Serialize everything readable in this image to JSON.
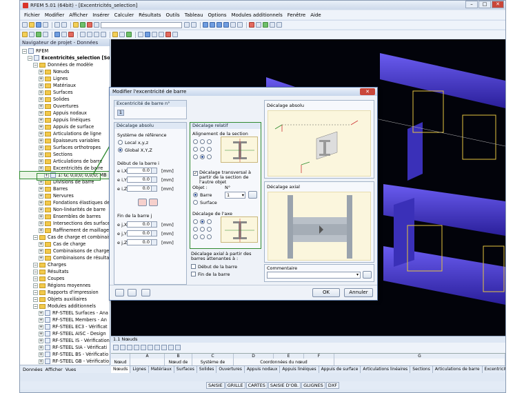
{
  "app": {
    "title": "RFEM 5.01 (64bit) - [Excentricités_selection]",
    "window_buttons": [
      "–",
      "□",
      "✕"
    ]
  },
  "menu": [
    "Fichier",
    "Modifier",
    "Afficher",
    "Insérer",
    "Calculer",
    "Résultats",
    "Outils",
    "Tableau",
    "Options",
    "Modules additionnels",
    "Fenêtre",
    "Aide"
  ],
  "navigator": {
    "title": "Navigateur de projet - Données",
    "tree": [
      {
        "label": "RFEM",
        "level": 0,
        "kind": "doc"
      },
      {
        "label": "Excentricités_selection [Sozial",
        "level": 1,
        "kind": "doc",
        "bold": true
      },
      {
        "label": "Données de modèle",
        "level": 2,
        "kind": "folder"
      },
      {
        "label": "Nœuds",
        "level": 3,
        "kind": "folder"
      },
      {
        "label": "Lignes",
        "level": 3,
        "kind": "folder"
      },
      {
        "label": "Matériaux",
        "level": 3,
        "kind": "folder"
      },
      {
        "label": "Surfaces",
        "level": 3,
        "kind": "folder"
      },
      {
        "label": "Solides",
        "level": 3,
        "kind": "folder"
      },
      {
        "label": "Ouvertures",
        "level": 3,
        "kind": "folder"
      },
      {
        "label": "Appuis nodaux",
        "level": 3,
        "kind": "folder"
      },
      {
        "label": "Appuis linéiques",
        "level": 3,
        "kind": "folder"
      },
      {
        "label": "Appuis de surface",
        "level": 3,
        "kind": "folder"
      },
      {
        "label": "Articulations de ligne",
        "level": 3,
        "kind": "folder"
      },
      {
        "label": "Épaisseurs variables",
        "level": 3,
        "kind": "folder"
      },
      {
        "label": "Surfaces orthotropes",
        "level": 3,
        "kind": "folder"
      },
      {
        "label": "Sections",
        "level": 3,
        "kind": "folder"
      },
      {
        "label": "Articulations de barre",
        "level": 3,
        "kind": "folder"
      },
      {
        "label": "Excentricités de barre",
        "level": 3,
        "kind": "folder"
      },
      {
        "label": "1: G; 0,0;0; 0,0;0; MB",
        "level": 4,
        "kind": "doc",
        "selected": true
      },
      {
        "label": "Divisions de barre",
        "level": 3,
        "kind": "folder"
      },
      {
        "label": "Barres",
        "level": 3,
        "kind": "folder"
      },
      {
        "label": "Nervures",
        "level": 3,
        "kind": "folder"
      },
      {
        "label": "Fondations élastiques de",
        "level": 3,
        "kind": "folder"
      },
      {
        "label": "Non-linéarités de barre",
        "level": 3,
        "kind": "folder"
      },
      {
        "label": "Ensembles de barres",
        "level": 3,
        "kind": "folder"
      },
      {
        "label": "Intersections des surface",
        "level": 3,
        "kind": "folder"
      },
      {
        "label": "Raffinement de maillage",
        "level": 3,
        "kind": "folder"
      },
      {
        "label": "Cas de charge et combinais",
        "level": 2,
        "kind": "folder"
      },
      {
        "label": "Cas de charge",
        "level": 3,
        "kind": "folder"
      },
      {
        "label": "Combinaisons de charge",
        "level": 3,
        "kind": "folder"
      },
      {
        "label": "Combinaisons de résulta",
        "level": 3,
        "kind": "folder"
      },
      {
        "label": "Charges",
        "level": 2,
        "kind": "folder"
      },
      {
        "label": "Résultats",
        "level": 2,
        "kind": "folder"
      },
      {
        "label": "Coupes",
        "level": 2,
        "kind": "folder"
      },
      {
        "label": "Régions moyennes",
        "level": 2,
        "kind": "folder"
      },
      {
        "label": "Rapports d'impression",
        "level": 2,
        "kind": "folder"
      },
      {
        "label": "Objets auxiliaires",
        "level": 2,
        "kind": "folder"
      },
      {
        "label": "Modules additionnels",
        "level": 2,
        "kind": "folder"
      },
      {
        "label": "RF-STEEL Surfaces - Ana",
        "level": 3,
        "kind": "doc"
      },
      {
        "label": "RF-STEEL Members - An",
        "level": 3,
        "kind": "doc"
      },
      {
        "label": "RF-STEEL EC3 - Vérificat",
        "level": 3,
        "kind": "doc"
      },
      {
        "label": "RF-STEEL AISC - Design",
        "level": 3,
        "kind": "doc"
      },
      {
        "label": "RF-STEEL IS - Vérification",
        "level": 3,
        "kind": "doc"
      },
      {
        "label": "RF-STEEL SIA - Vérificati",
        "level": 3,
        "kind": "doc"
      },
      {
        "label": "RF-STEEL BS - Vérificatio",
        "level": 3,
        "kind": "doc"
      },
      {
        "label": "RF-STEEL GB - Vérificatio",
        "level": 3,
        "kind": "doc"
      }
    ],
    "tabs": [
      "Données",
      "Afficher",
      "Vues"
    ]
  },
  "dialog": {
    "title": "Modifier l'excentricité de barre",
    "ecc_no_label": "Excentricité de barre n°",
    "ecc_no_value": "1",
    "abs_group": "Décalage absolu",
    "ref_system": "Système de référence",
    "local": "Local x,y,z",
    "global": "Global X,Y,Z",
    "start_label": "Début de la barre i",
    "end_label": "Fin de la barre j",
    "start_fields": [
      {
        "label": "e i,X",
        "value": "0.0",
        "unit": "[mm]"
      },
      {
        "label": "e i,Y",
        "value": "0.0",
        "unit": "[mm]"
      },
      {
        "label": "e i,Z",
        "value": "0.0",
        "unit": "[mm]"
      }
    ],
    "end_fields": [
      {
        "label": "e j,X",
        "value": "0.0",
        "unit": "[mm]"
      },
      {
        "label": "e j,Y",
        "value": "0.0",
        "unit": "[mm]"
      },
      {
        "label": "e j,Z",
        "value": "0.0",
        "unit": "[mm]"
      }
    ],
    "rel_group": "Décalage relatif",
    "section_align": "Alignement de la section",
    "transverse_check": "Décalage transversal à partir de la section de l'autre objet",
    "objet_label": "Objet :",
    "n_label": "N°",
    "objet_bar": "Barre",
    "objet_surface": "Surface",
    "objet_no": "1",
    "axis_offset": "Décalage de l'axe",
    "axial_offset": "Décalage axial à partir des barres attenantes à :",
    "axial_start": "Début de la barre",
    "axial_end": "Fin de la barre",
    "img_abs_title": "Décalage absolu",
    "img_axial_title": "Décalage axial",
    "comment_label": "Commentaire",
    "ok": "OK",
    "cancel": "Annuler"
  },
  "table": {
    "title": "1.1 Nœuds",
    "col_letters": [
      "A",
      "B",
      "C",
      "D",
      "E",
      "F",
      "G"
    ],
    "headers": [
      "Nœud",
      "Nœud de",
      "Système de",
      "Coordonnées du nœud"
    ],
    "sheets": [
      "Nœuds",
      "Lignes",
      "Matériaux",
      "Surfaces",
      "Solides",
      "Ouvertures",
      "Appuis nodaux",
      "Appuis linéiques",
      "Appuis de surface",
      "Articulations linéaires",
      "Sections",
      "Articulations de barre",
      "Excentricités de barre"
    ]
  },
  "status": [
    "SAISIE",
    "GRILLE",
    "CARTES",
    "SAISIE D'OB.",
    "GLIGNES",
    "DXF"
  ],
  "colors": {
    "beam": "#4a3fd0",
    "highlight": "#2f8a2f",
    "viewport": "#02030a"
  }
}
